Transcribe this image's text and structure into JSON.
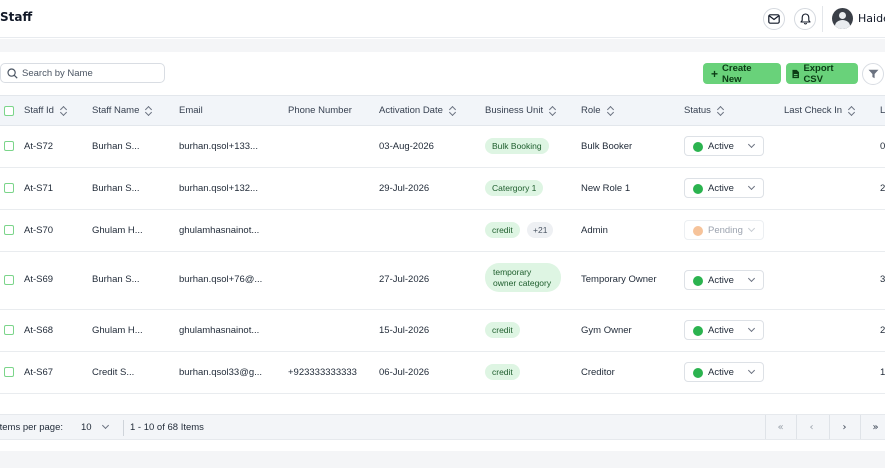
{
  "header": {
    "title": "Staff",
    "user_name": "Haide",
    "icons": [
      "mail-icon",
      "bell-icon",
      "avatar"
    ]
  },
  "toolbar": {
    "search_placeholder": "Search by Name",
    "create_label": "Create New",
    "export_label": "Export CSV"
  },
  "colors": {
    "accent": "#69d27a",
    "active_dot": "#2bb34f",
    "pending_dot": "#f6c39a",
    "tag_bg": "#def5e3"
  },
  "table": {
    "columns": [
      "Staff Id",
      "Staff Name",
      "Email",
      "Phone Number",
      "Activation Date",
      "Business Unit",
      "Role",
      "Status",
      "Last Check In",
      "L"
    ],
    "rows": [
      {
        "id": "At-S72",
        "name": "Burhan S...",
        "email": "burhan.qsol+133...",
        "phone": "",
        "activation": "03-Aug-2026",
        "unit": "Bulk Booking",
        "unit_more": "",
        "role": "Bulk Booker",
        "status": "Active",
        "last": "",
        "extra": "0"
      },
      {
        "id": "At-S71",
        "name": "Burhan S...",
        "email": "burhan.qsol+132...",
        "phone": "",
        "activation": "29-Jul-2026",
        "unit": "Catergory 1",
        "unit_more": "",
        "role": "New Role 1",
        "status": "Active",
        "last": "",
        "extra": "2"
      },
      {
        "id": "At-S70",
        "name": "Ghulam H...",
        "email": "ghulamhasnainot...",
        "phone": "",
        "activation": "",
        "unit": "credit",
        "unit_more": "+21",
        "role": "Admin",
        "status": "Pending",
        "last": "",
        "extra": ""
      },
      {
        "id": "At-S69",
        "name": "Burhan S...",
        "email": "burhan.qsol+76@...",
        "phone": "",
        "activation": "27-Jul-2026",
        "unit": "temporary owner category",
        "unit_more": "",
        "role": "Temporary Owner",
        "status": "Active",
        "last": "",
        "extra": "3"
      },
      {
        "id": "At-S68",
        "name": "Ghulam H...",
        "email": "ghulamhasnainot...",
        "phone": "",
        "activation": "15-Jul-2026",
        "unit": "credit",
        "unit_more": "",
        "role": "Gym Owner",
        "status": "Active",
        "last": "",
        "extra": "2"
      },
      {
        "id": "At-S67",
        "name": "Credit S...",
        "email": "burhan.qsol33@g...",
        "phone": "+923333333333",
        "activation": "06-Jul-2026",
        "unit": "credit",
        "unit_more": "",
        "role": "Creditor",
        "status": "Active",
        "last": "",
        "extra": "1"
      }
    ]
  },
  "pagination": {
    "per_page_label": "Items per page:",
    "per_page_value": "10",
    "range_text": "1 - 10 of 68 Items",
    "first": "«",
    "prev": "‹",
    "next": "›",
    "last": "»"
  }
}
